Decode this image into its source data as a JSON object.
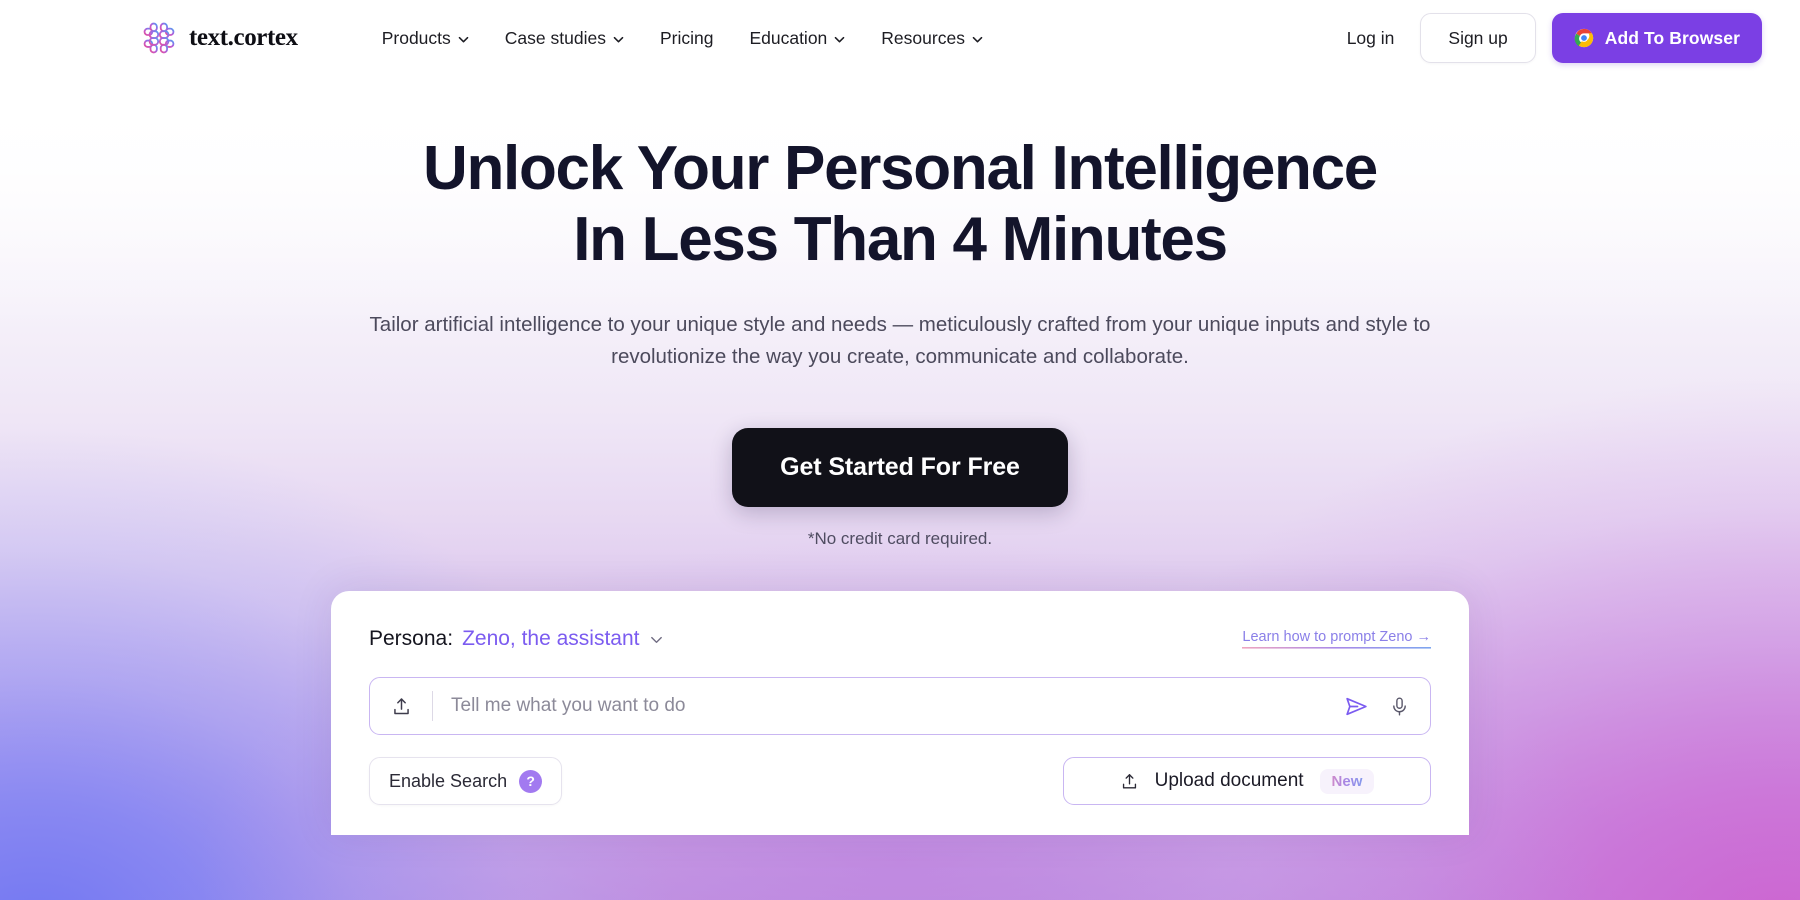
{
  "brand": {
    "name": "text.cortex",
    "logo_icon": "brain-petals-logo"
  },
  "nav": {
    "items": [
      {
        "label": "Products",
        "has_dropdown": true,
        "icon": "chevron-down-icon"
      },
      {
        "label": "Case studies",
        "has_dropdown": true,
        "icon": "chevron-down-icon"
      },
      {
        "label": "Pricing",
        "has_dropdown": false,
        "icon": ""
      },
      {
        "label": "Education",
        "has_dropdown": true,
        "icon": "chevron-down-icon"
      },
      {
        "label": "Resources",
        "has_dropdown": true,
        "icon": "chevron-down-icon"
      }
    ],
    "login_label": "Log in",
    "signup_label": "Sign up",
    "add_browser_label": "Add To Browser",
    "add_browser_icon": "chrome-icon"
  },
  "hero": {
    "headline_line1": "Unlock Your Personal Intelligence",
    "headline_line2": "In Less Than 4 Minutes",
    "subhead_line1": "Tailor artificial intelligence to your unique style and needs — meticulously crafted from your unique inputs and",
    "subhead_line2": "style to revolutionize the way you create, communicate and collaborate.",
    "cta_label": "Get Started For Free",
    "cta_note": "*No credit card required."
  },
  "prompt_card": {
    "persona_label": "Persona:",
    "persona_value": "Zeno, the assistant",
    "persona_chevron_icon": "chevron-down-icon",
    "learn_link": "Learn how to prompt Zeno →",
    "upload_icon": "upload-icon",
    "input_placeholder": "Tell me what you want to do",
    "input_value": "",
    "send_icon": "send-paper-plane-icon",
    "mic_icon": "microphone-icon",
    "enable_search_label": "Enable Search",
    "enable_search_help": "?",
    "upload_document_label": "Upload document",
    "upload_document_icon": "upload-icon",
    "upload_document_badge": "New"
  },
  "colors": {
    "accent_purple": "#7b3fe4",
    "persona_purple": "#7b5bf0",
    "cta_dark": "#111118",
    "headline": "#13142b",
    "bg_blue": "#6e76f3",
    "bg_magenta": "#ce62d0"
  }
}
